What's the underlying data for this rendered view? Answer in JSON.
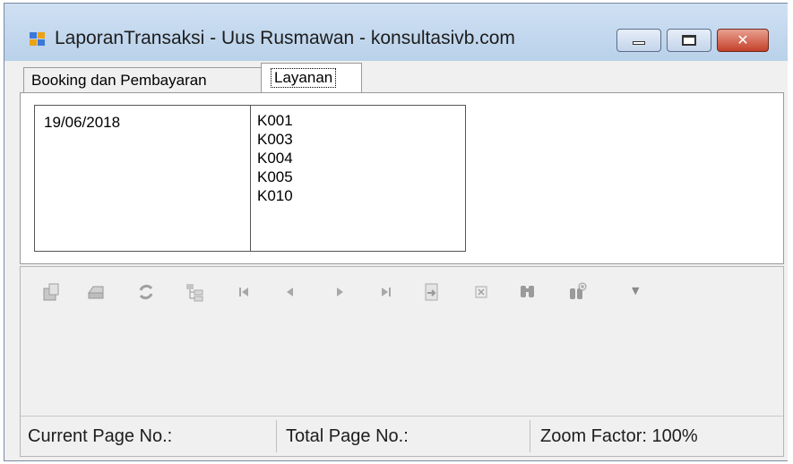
{
  "window": {
    "title": "LaporanTransaksi - Uus Rusmawan - konsultasivb.com",
    "close_glyph": "✕"
  },
  "tabs": [
    {
      "label": "Booking dan Pembayaran",
      "active": false
    },
    {
      "label": "Layanan",
      "active": true
    }
  ],
  "report": {
    "date": "19/06/2018",
    "codes": [
      "K001",
      "K003",
      "K004",
      "K005",
      "K010"
    ]
  },
  "toolbar": {
    "icons": [
      "export-icon",
      "print-icon",
      "refresh-icon",
      "group-tree-icon",
      "first-page-icon",
      "previous-page-icon",
      "next-page-icon",
      "last-page-icon",
      "goto-page-icon",
      "stop-icon",
      "search-icon",
      "zoom-icon"
    ],
    "zoom_caret": "▼"
  },
  "status": {
    "current_page_label": "Current Page No.:",
    "total_page_label": "Total Page No.:",
    "zoom_label": "Zoom Factor: 100%"
  }
}
